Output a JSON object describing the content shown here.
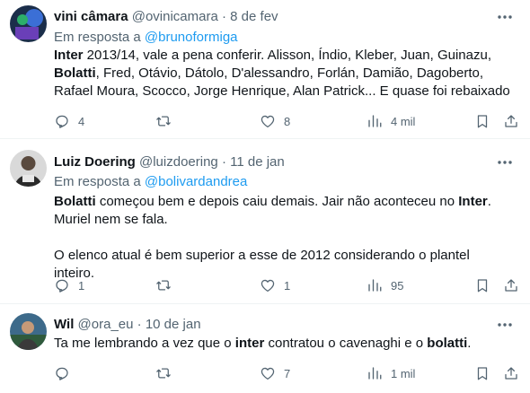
{
  "colors": {
    "accent": "#1d9bf0",
    "muted": "#536471",
    "text": "#0f1419"
  },
  "tweets": [
    {
      "name": "vini câmara",
      "handle": "@ovinicamara",
      "date": "· 8 de fev",
      "reply_prefix": "Em resposta a ",
      "reply_handle": "@brunoformiga",
      "paragraphs": [
        [
          {
            "t": "Inter",
            "b": true
          },
          {
            "t": " 2013/14, vale a pena conferir. Alisson, Índio, Kleber, Juan, Guinazu, "
          },
          {
            "t": "Bolatti",
            "b": true
          },
          {
            "t": ", Fred, Otávio, Dátolo, D'alessandro, Forlán, Damião, Dagoberto, Rafael Moura, Scocco, Jorge Henrique, Alan Patrick... E quase foi rebaixado"
          }
        ]
      ],
      "stats": {
        "replies": "4",
        "retweets": "",
        "likes": "8",
        "views": "4 mil"
      }
    },
    {
      "name": "Luiz Doering",
      "handle": "@luizdoering",
      "date": "· 11 de jan",
      "reply_prefix": "Em resposta a ",
      "reply_handle": "@bolivardandrea",
      "paragraphs": [
        [
          {
            "t": "Bolatti",
            "b": true
          },
          {
            "t": " começou bem e depois caiu demais. Jair não aconteceu no "
          },
          {
            "t": "Inter",
            "b": true
          },
          {
            "t": ". Muriel nem se fala."
          }
        ],
        [
          {
            "t": "O elenco atual é bem superior a esse de 2012 considerando o plantel inteiro."
          }
        ]
      ],
      "stats": {
        "replies": "1",
        "retweets": "",
        "likes": "1",
        "views": "95"
      }
    },
    {
      "name": "Wil",
      "handle": "@ora_eu",
      "date": "· 10 de jan",
      "reply_prefix": "",
      "reply_handle": "",
      "paragraphs": [
        [
          {
            "t": "Ta me lembrando a vez que o "
          },
          {
            "t": "inter",
            "b": true
          },
          {
            "t": " contratou o cavenaghi e o "
          },
          {
            "t": "bolatti",
            "b": true
          },
          {
            "t": "."
          }
        ]
      ],
      "stats": {
        "replies": "",
        "retweets": "",
        "likes": "7",
        "views": "1 mil"
      }
    }
  ]
}
